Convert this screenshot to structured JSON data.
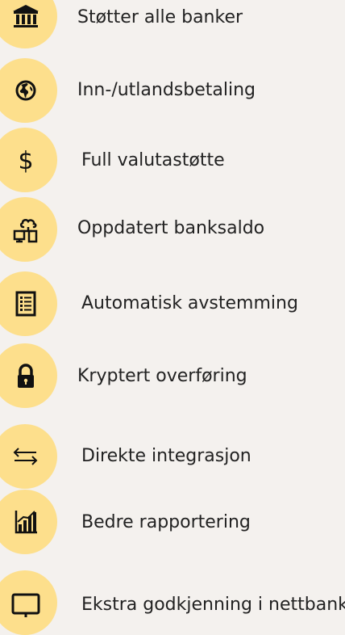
{
  "features": [
    {
      "label": "Støtter alle banker",
      "icon": "bank-icon"
    },
    {
      "label": "Inn-/utlandsbetaling",
      "icon": "globe-icon"
    },
    {
      "label": "Full valutastøtte",
      "icon": "dollar-icon"
    },
    {
      "label": "Oppdatert banksaldo",
      "icon": "cloud-computers-icon"
    },
    {
      "label": "Automatisk avstemming",
      "icon": "checklist-icon"
    },
    {
      "label": "Kryptert overføring",
      "icon": "lock-icon"
    },
    {
      "label": "Direkte integrasjon",
      "icon": "transfer-arrows-icon"
    },
    {
      "label": "Bedre rapportering",
      "icon": "bar-chart-icon"
    },
    {
      "label": "Ekstra godkjenning i nettbank",
      "icon": "monitor-icon"
    }
  ],
  "colors": {
    "background": "#f4f1ee",
    "circle": "#fddf8c",
    "icon": "#111111",
    "text": "#222222"
  }
}
